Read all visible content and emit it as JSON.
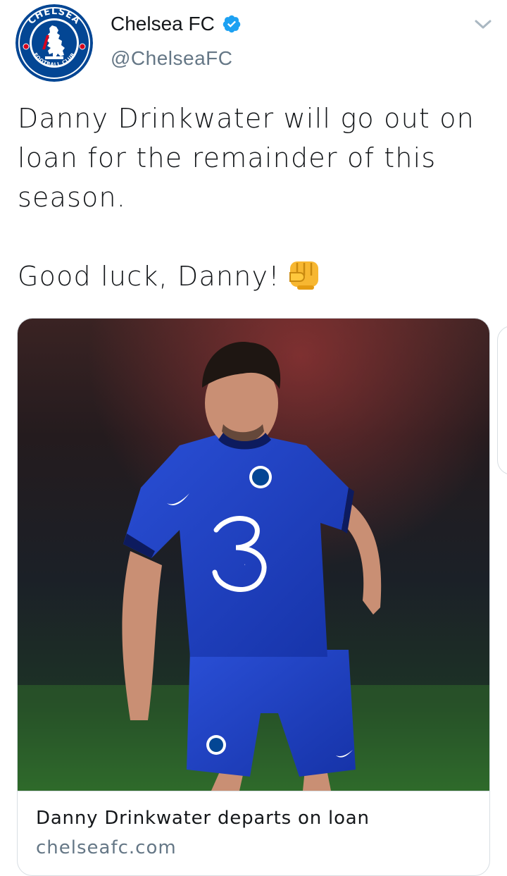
{
  "tweet": {
    "author": {
      "name": "Chelsea FC",
      "handle": "@ChelseaFC",
      "verified": true,
      "avatar_icon": "chelsea-football-club-crest",
      "avatar_crest_text": [
        "CHELSEA",
        "FOOTBALL CLUB"
      ]
    },
    "menu_icon": "chevron-down-icon",
    "text_lines": [
      "Danny Drinkwater will go out on",
      "loan for the remainder of this",
      "season."
    ],
    "text_second": "Good luck, Danny!",
    "emoji": "oncoming-fist-icon",
    "card": {
      "title": "Danny Drinkwater departs on loan",
      "domain": "chelseafc.com",
      "image_kit_text": "3"
    }
  },
  "colors": {
    "text": "#14171a",
    "muted": "#657786",
    "verified": "#1da1f2",
    "chelsea_blue": "#034694",
    "kit_blue": "#1b3fbf",
    "border": "#d8dee3"
  }
}
